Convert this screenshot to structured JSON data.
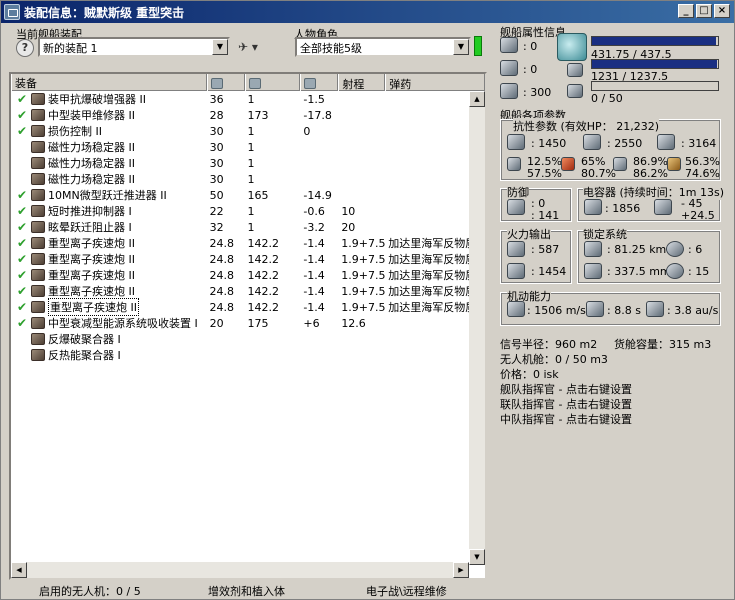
{
  "window": {
    "title": "装配信息：贼默斯级 重型突击",
    "buttons": [
      "_",
      "□",
      "×"
    ]
  },
  "fitting": {
    "label": "当前舰船装配",
    "selected": "新的装配 1"
  },
  "character": {
    "label": "人物角色",
    "selected": "全部技能5级"
  },
  "columns": [
    "装备",
    "",
    "",
    "",
    "射程",
    "弹药"
  ],
  "modules": [
    {
      "checked": true,
      "name": "装甲抗爆破增强器 II",
      "cpu": "36",
      "pg": "1",
      "cap": "-1.5",
      "range": "",
      "ammo": ""
    },
    {
      "checked": true,
      "name": "中型装甲维修器 II",
      "cpu": "28",
      "pg": "173",
      "cap": "-17.8",
      "range": "",
      "ammo": ""
    },
    {
      "checked": true,
      "name": "损伤控制 II",
      "cpu": "30",
      "pg": "1",
      "cap": "0",
      "range": "",
      "ammo": ""
    },
    {
      "checked": false,
      "name": "磁性力场稳定器 II",
      "cpu": "30",
      "pg": "1",
      "cap": "",
      "range": "",
      "ammo": ""
    },
    {
      "checked": false,
      "name": "磁性力场稳定器 II",
      "cpu": "30",
      "pg": "1",
      "cap": "",
      "range": "",
      "ammo": ""
    },
    {
      "checked": false,
      "name": "磁性力场稳定器 II",
      "cpu": "30",
      "pg": "1",
      "cap": "",
      "range": "",
      "ammo": ""
    },
    {
      "checked": true,
      "name": "10MN微型跃迁推进器 II",
      "cpu": "50",
      "pg": "165",
      "cap": "-14.9",
      "range": "",
      "ammo": ""
    },
    {
      "checked": true,
      "name": "短时推进抑制器 I",
      "cpu": "22",
      "pg": "1",
      "cap": "-0.6",
      "range": "10",
      "ammo": ""
    },
    {
      "checked": true,
      "name": "眩晕跃迁阻止器 I",
      "cpu": "32",
      "pg": "1",
      "cap": "-3.2",
      "range": "20",
      "ammo": ""
    },
    {
      "checked": true,
      "name": "重型离子疾速炮 II",
      "cpu": "24.8",
      "pg": "142.2",
      "cap": "-1.4",
      "range": "1.9+7.5",
      "ammo": "加达里海军反物质轨"
    },
    {
      "checked": true,
      "name": "重型离子疾速炮 II",
      "cpu": "24.8",
      "pg": "142.2",
      "cap": "-1.4",
      "range": "1.9+7.5",
      "ammo": "加达里海军反物质轨"
    },
    {
      "checked": true,
      "name": "重型离子疾速炮 II",
      "cpu": "24.8",
      "pg": "142.2",
      "cap": "-1.4",
      "range": "1.9+7.5",
      "ammo": "加达里海军反物质轨"
    },
    {
      "checked": true,
      "name": "重型离子疾速炮 II",
      "cpu": "24.8",
      "pg": "142.2",
      "cap": "-1.4",
      "range": "1.9+7.5",
      "ammo": "加达里海军反物质轨"
    },
    {
      "checked": true,
      "name": "重型离子疾速炮 II",
      "cpu": "24.8",
      "pg": "142.2",
      "cap": "-1.4",
      "range": "1.9+7.5",
      "ammo": "加达里海军反物质轨"
    },
    {
      "checked": true,
      "name": "中型衰减型能源系统吸收装置 I",
      "cpu": "20",
      "pg": "175",
      "cap": "+6",
      "range": "12.6",
      "ammo": ""
    },
    {
      "checked": false,
      "name": "反爆破聚合器 I",
      "cpu": "",
      "pg": "",
      "cap": "",
      "range": "",
      "ammo": ""
    },
    {
      "checked": false,
      "name": "反热能聚合器 I",
      "cpu": "",
      "pg": "",
      "cap": "",
      "range": "",
      "ammo": ""
    }
  ],
  "status": {
    "drones": "启用的无人机：0 / 5",
    "implants": "增效剂和植入体",
    "ewar": "电子战\\远程维修"
  },
  "ship_attrs": {
    "title": "舰船属性信息",
    "turret": ": 0",
    "launcher": ": 0",
    "drone_bw": ": 300",
    "cpu": "431.75 / 437.5",
    "pg": "1231 / 1237.5",
    "calib": "0 / 50",
    "cpu_ratio": 0.987,
    "pg_ratio": 0.995,
    "calib_ratio": 0.0
  },
  "params": {
    "title": "舰船各项参数",
    "resist_title": "抗性参数 (有效HP：",
    "ehp": "21,232)",
    "shield_hp": ": 1450",
    "armor_hp": ": 2550",
    "hull_hp": ": 3164",
    "shield_res": [
      "12.5%",
      "57.5%"
    ],
    "armor_res": [
      "65%",
      "80.7%"
    ],
    "armor_res2": [
      "86.9%",
      "86.2%"
    ],
    "hull_res": [
      "56.3%",
      "74.6%"
    ],
    "defense_title": "防御",
    "defense_vals": [
      ": 0",
      ": 141"
    ],
    "cap_title": "电容器 (持续时间：1m 13s)",
    "cap_amount": ": 1856",
    "cap_delta": [
      "- 45",
      "+24.5"
    ],
    "fire_title": "火力输出",
    "fire_vals": [
      ": 587",
      ": 1454"
    ],
    "lock_title": "锁定系统",
    "lock_range": ": 81.25 km",
    "lock_targets": ": 6",
    "scan_res": ": 337.5 mm",
    "sensor": ": 15",
    "mobility_title": "机动能力",
    "speed": ": 1506 m/s",
    "align": ": 8.8 s",
    "warp": ": 3.8 au/s",
    "signature": "信号半径：960 m2",
    "cargo": "货舱容量：315 m3",
    "drone_bay": "无人机舱：0 / 50 m3",
    "price": "价格：0 isk",
    "fleet_boss": "舰队指挥官 - 点击右键设置",
    "wing_boss": "联队指挥官 - 点击右键设置",
    "squad_boss": "中队指挥官 - 点击右键设置"
  }
}
